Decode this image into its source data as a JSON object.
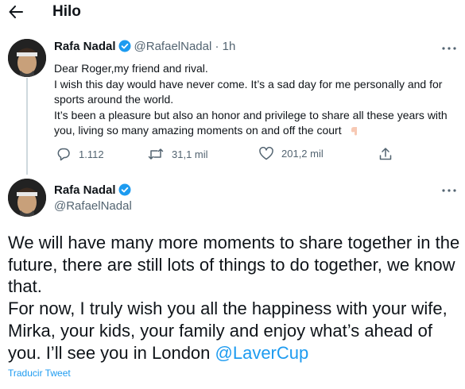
{
  "header": {
    "title": "Hilo",
    "back_icon": "arrow-left-icon"
  },
  "tweet1": {
    "author_name": "Rafa Nadal",
    "handle_time": "@RafaelNadal · 1h",
    "lines": [
      "Dear Roger,my friend and rival.",
      "I wish this day would have never come. It’s a sad day for me personally and for sports around the world.",
      "It’s been a pleasure but also an honor and privilege to share all these years with you, living so many amazing moments on and off the court"
    ],
    "emoji": "point-down-hand-icon",
    "actions": {
      "replies": "1.112",
      "retweets": "31,1 mil",
      "likes": "201,2 mil"
    }
  },
  "tweet2": {
    "author_name": "Rafa Nadal",
    "handle": "@RafaelNadal",
    "para1": "We will have many more moments to share together in the future, there are still lots of things to do together, we know that.",
    "para2": "For now, I truly wish you all the happiness with your wife, Mirka, your kids, your family and enjoy what’s ahead of you. I’ll see you in London ",
    "mention": "@LaverCup",
    "translate_label": "Traducir Tweet"
  },
  "colors": {
    "accent": "#1d9bf0",
    "text": "#0f1419",
    "secondary": "#536471",
    "thread_line": "#cfd9de"
  }
}
